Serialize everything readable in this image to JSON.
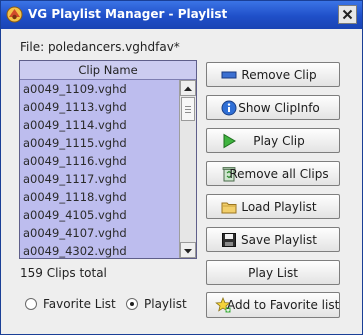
{
  "window": {
    "title": "VG Playlist Manager - Playlist"
  },
  "file_label": "File: poledancers.vghdfav*",
  "clip_list": {
    "header": "Clip Name",
    "items": [
      "a0049_1109.vghd",
      "a0049_1113.vghd",
      "a0049_1114.vghd",
      "a0049_1115.vghd",
      "a0049_1116.vghd",
      "a0049_1117.vghd",
      "a0049_1118.vghd",
      "a0049_4105.vghd",
      "a0049_4107.vghd",
      "a0049_4302.vghd"
    ]
  },
  "clips_total": "159 Clips total",
  "buttons": {
    "remove_clip": "Remove Clip",
    "show_clipinfo": "Show ClipInfo",
    "play_clip": "Play Clip",
    "remove_all": "Remove all Clips",
    "load_playlist": "Load Playlist",
    "save_playlist": "Save Playlist",
    "play_list": "Play List",
    "add_favorite": "Add to Favorite list"
  },
  "radio": {
    "favorite_list": "Favorite List",
    "playlist": "Playlist",
    "selected": "playlist"
  },
  "icons": {
    "app": "app-logo-icon",
    "close": "close-icon",
    "remove_clip": "minus-bar-icon",
    "show_clipinfo": "info-icon",
    "play_clip": "play-icon",
    "remove_all": "recycle-bin-icon",
    "load_playlist": "folder-icon",
    "save_playlist": "floppy-disk-icon",
    "add_favorite": "star-add-icon"
  },
  "colors": {
    "titlebar": "#2457d6",
    "list_background": "#bdbdee",
    "list_header": "#ccccf0"
  }
}
